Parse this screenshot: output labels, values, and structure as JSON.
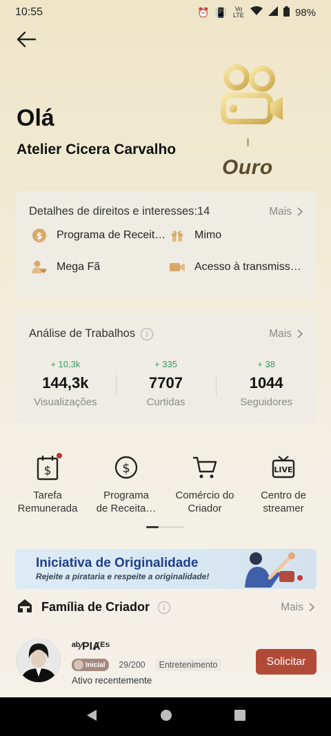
{
  "status_bar": {
    "time": "10:55",
    "network_label": "Vo LTE",
    "battery": "98%"
  },
  "header": {
    "greeting": "Olá",
    "username": "Atelier Cicera Carvalho",
    "level": "Ouro"
  },
  "rights": {
    "title": "Detalhes de direitos e interesses:14",
    "more": "Mais",
    "items": [
      {
        "label": "Programa de Receit…",
        "icon": "dollar-coin-icon"
      },
      {
        "label": "Mimo",
        "icon": "gift-icon"
      },
      {
        "label": "Mega Fã",
        "icon": "fan-heart-icon"
      },
      {
        "label": "Acesso à transmiss…",
        "icon": "video-camera-icon"
      }
    ]
  },
  "analysis": {
    "title": "Análise de Trabalhos",
    "more": "Mais",
    "stats": [
      {
        "delta": "+ 10,3k",
        "value": "144,3k",
        "label": "Visualizações"
      },
      {
        "delta": "+ 335",
        "value": "7707",
        "label": "Curtidas"
      },
      {
        "delta": "+ 38",
        "value": "1044",
        "label": "Seguidores"
      }
    ]
  },
  "tools": [
    {
      "line1": "Tarefa",
      "line2": "Remunerada",
      "icon": "paid-task-icon"
    },
    {
      "line1": "Programa",
      "line2": "de Receita…",
      "icon": "dollar-circle-icon"
    },
    {
      "line1": "Comércio do",
      "line2": "Criador",
      "icon": "shopping-cart-icon"
    },
    {
      "line1": "Centro de",
      "line2": "streamer",
      "icon": "live-tv-icon"
    }
  ],
  "banner": {
    "title": "Iniciativa de Originalidade",
    "subtitle": "Rejeite a pirataria e respeite a originalidade!"
  },
  "family": {
    "title": "Família de Criador",
    "more": "Mais",
    "item": {
      "name": "ᵃᵇ⁄PIȺᴱ⁵",
      "level_tag": "Inicial",
      "members": "29/200",
      "category": "Entretenimento",
      "status": "Ativo recentemente",
      "action": "Solicitar"
    }
  },
  "colors": {
    "accent_red": "#b14a37",
    "delta_green": "#3d9a6a",
    "banner_blue": "#1e3f8f",
    "level_brown": "#5a4a2e"
  }
}
